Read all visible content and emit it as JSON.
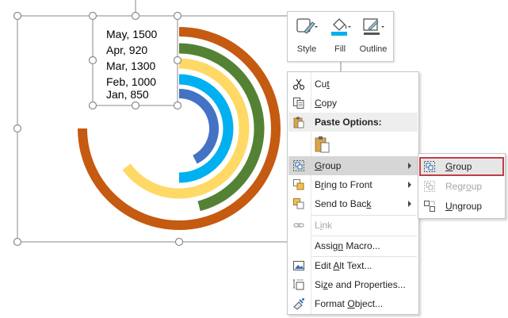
{
  "text_box": {
    "lines": [
      "May, 1500",
      "Apr, 920",
      "Mar, 1300",
      "Feb, 1000",
      "Jan, 850"
    ]
  },
  "rings": [
    {
      "label": "May",
      "value": 1500,
      "color": "#c55a11"
    },
    {
      "label": "Apr",
      "value": 920,
      "color": "#548235"
    },
    {
      "label": "Mar",
      "value": 1300,
      "color": "#ffd966"
    },
    {
      "label": "Feb",
      "value": 1000,
      "color": "#00b0f0"
    },
    {
      "label": "Jan",
      "value": 850,
      "color": "#4472c4"
    }
  ],
  "toolbar": {
    "style_label": "Style",
    "fill_label": "Fill",
    "outline_label": "Outline",
    "fill_color": "#00b0f0"
  },
  "menu": {
    "cut": "Cut",
    "copy": "Copy",
    "paste_options": "Paste Options:",
    "group": "Group",
    "bring_to_front": "Bring to Front",
    "send_to_back": "Send to Back",
    "link": "Link",
    "assign_macro": "Assign Macro...",
    "edit_alt_text": "Edit Alt Text...",
    "size_and_properties": "Size and Properties...",
    "format_object": "Format Object..."
  },
  "submenu": {
    "group": "Group",
    "regroup": "Regroup",
    "ungroup": "Ungroup"
  },
  "colors": {
    "selection_outline": "#c23d4a",
    "hover": "#d6d6d6"
  }
}
